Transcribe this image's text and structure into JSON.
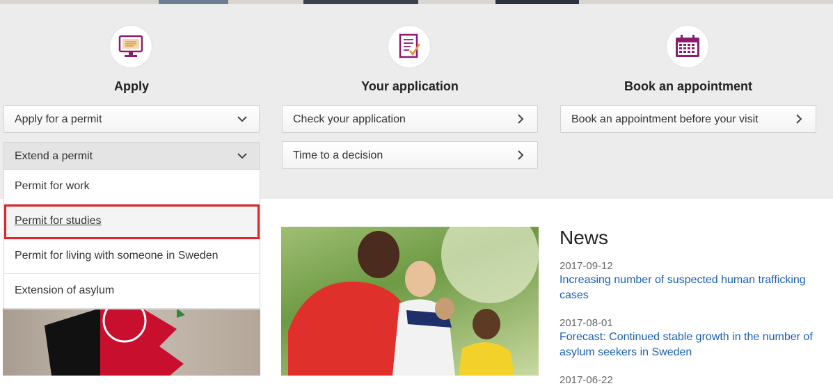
{
  "columns": {
    "apply": {
      "title": "Apply",
      "icon": "monitor-document-icon",
      "buttons": [
        "Apply for a permit",
        "Extend a permit"
      ]
    },
    "application": {
      "title": "Your application",
      "icon": "checklist-icon",
      "buttons": [
        "Check your application",
        "Time to a decision"
      ]
    },
    "appointment": {
      "title": "Book an appointment",
      "icon": "calendar-icon",
      "buttons": [
        "Book an appointment before your visit"
      ]
    }
  },
  "extend_menu": {
    "items": [
      "Permit for work",
      "Permit for studies",
      "Permit for living with someone in Sweden",
      "Extension of asylum"
    ],
    "highlighted_index": 1
  },
  "news": {
    "title": "News",
    "items": [
      {
        "date": "2017-09-12",
        "headline": "Increasing number of suspected human trafficking cases"
      },
      {
        "date": "2017-08-01",
        "headline": "Forecast: Continued stable growth in the number of asylum seekers in Sweden"
      },
      {
        "date": "2017-06-22",
        "headline": ""
      }
    ]
  },
  "colors": {
    "accent": "#8a1d6e",
    "link": "#1a5fb4",
    "highlight_border": "#e2222a"
  }
}
